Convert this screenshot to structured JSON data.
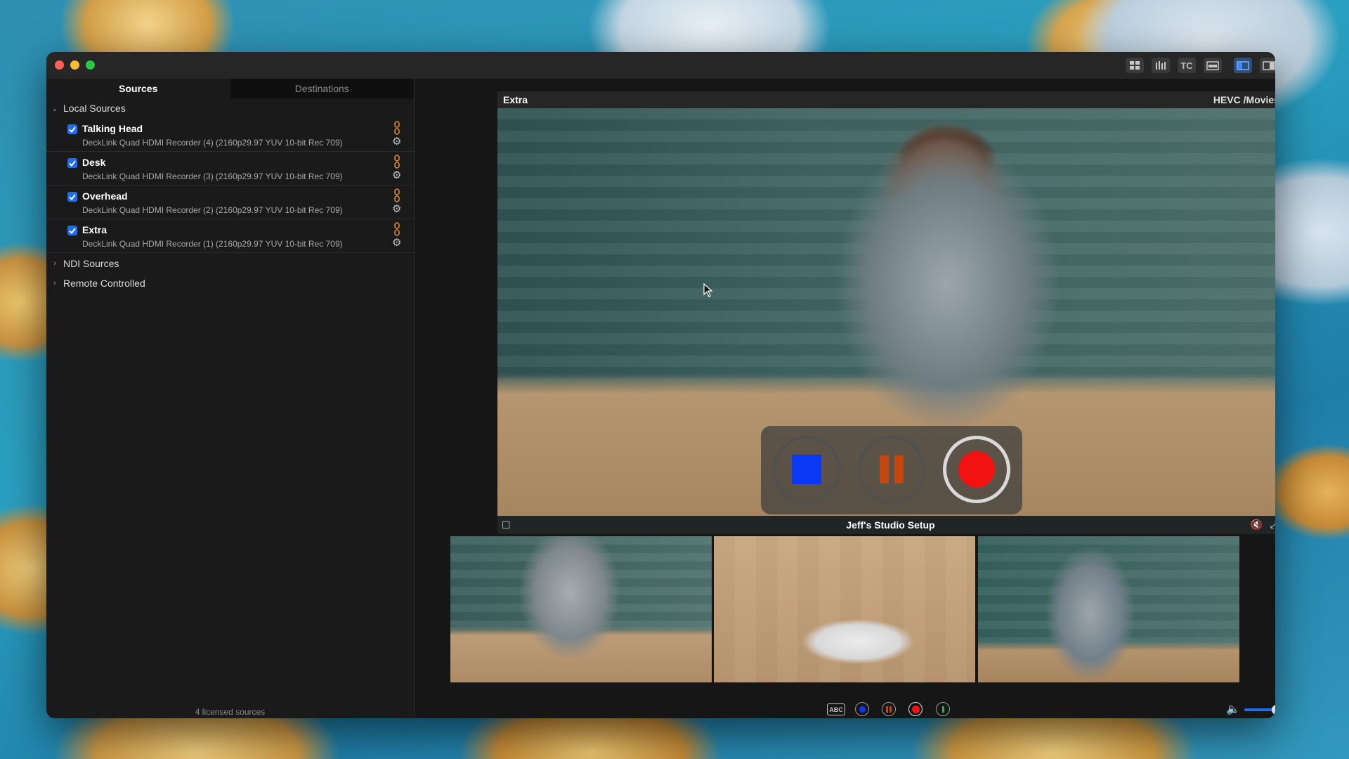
{
  "window": {
    "toolbar": {
      "grid_view": "grid-view-icon",
      "audio_meters": "audio-meters-icon",
      "timecode_label": "TC",
      "single_view": "single-view-icon",
      "layout_left": "layout-left-icon",
      "layout_right": "layout-right-icon"
    }
  },
  "sidebar": {
    "tabs": [
      {
        "label": "Sources",
        "active": true
      },
      {
        "label": "Destinations",
        "active": false
      }
    ],
    "groups": {
      "local": {
        "label": "Local Sources",
        "expanded": true
      },
      "ndi": {
        "label": "NDI Sources",
        "expanded": false
      },
      "remote": {
        "label": "Remote Controlled",
        "expanded": false
      }
    },
    "sources": [
      {
        "name": "Talking Head",
        "device": "DeckLink Quad HDMI Recorder (4) (2160p29.97 YUV 10-bit Rec 709)",
        "checked": true
      },
      {
        "name": "Desk",
        "device": "DeckLink Quad HDMI Recorder (3) (2160p29.97 YUV 10-bit Rec 709)",
        "checked": true
      },
      {
        "name": "Overhead",
        "device": "DeckLink Quad HDMI Recorder (2) (2160p29.97 YUV 10-bit Rec 709)",
        "checked": true
      },
      {
        "name": "Extra",
        "device": "DeckLink Quad HDMI Recorder (1) (2160p29.97 YUV 10-bit Rec 709)",
        "checked": true
      }
    ],
    "footer": "4 licensed sources"
  },
  "viewer": {
    "title": "Extra",
    "destination": "HEVC /Movies",
    "caption": "Jeff's Studio Setup"
  },
  "transport": {
    "stop_color": "#0a38f5",
    "pause_color": "#c4470f",
    "record_color": "#f21212"
  },
  "bottom": {
    "abc_label": "ABC",
    "volume": 0.62
  },
  "colors": {
    "accent": "#1e6df6",
    "link_orange": "#e08a2a"
  }
}
